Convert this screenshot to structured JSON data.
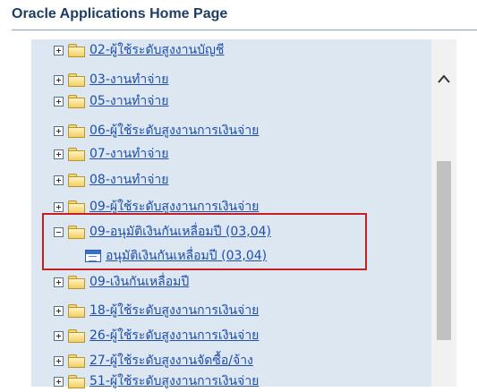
{
  "header": {
    "title": "Oracle Applications Home Page"
  },
  "tree": {
    "items": [
      {
        "type": "folder",
        "expander": "plus",
        "label": "02-ผู้ใช้ระดับสูงงานบัญชี"
      },
      {
        "type": "folder",
        "expander": "plus",
        "label": "03-งานทำจ่าย"
      },
      {
        "type": "folder",
        "expander": "plus",
        "label": "05-งานทำจ่าย"
      },
      {
        "type": "folder",
        "expander": "plus",
        "label": "06-ผู้ใช้ระดับสูงงานการเงินจ่าย"
      },
      {
        "type": "folder",
        "expander": "plus",
        "label": "07-งานทำจ่าย"
      },
      {
        "type": "folder",
        "expander": "plus",
        "label": "08-งานทำจ่าย"
      },
      {
        "type": "folder",
        "expander": "plus",
        "label": "09-ผู้ใช้ระดับสูงงานการเงินจ่าย"
      },
      {
        "type": "folder",
        "expander": "minus",
        "label": "09-อนุมัติเงินกันเหลื่อมปี (03,04)"
      },
      {
        "type": "function",
        "label": "อนุมัติเงินกันเหลื่อมปี (03,04)"
      },
      {
        "type": "folder",
        "expander": "plus",
        "label": "09-เงินกันเหลื่อมปี"
      },
      {
        "type": "folder",
        "expander": "plus",
        "label": "18-ผู้ใช้ระดับสูงงานการเงินจ่าย"
      },
      {
        "type": "folder",
        "expander": "plus",
        "label": "26-ผู้ใช้ระดับสูงงานการเงินจ่าย"
      },
      {
        "type": "folder",
        "expander": "plus",
        "label": "27-ผู้ใช้ระดับสูงงานจัดซื้อ/จ้าง"
      },
      {
        "type": "folder",
        "expander": "plus",
        "label": "51-ผู้ใช้ระดับสูงงานการเงินจ่าย"
      }
    ]
  },
  "scrollbar": {
    "up_icon": "chevron-up-icon"
  },
  "colors": {
    "link": "#1f4fa8",
    "highlight": "#c42024",
    "panel": "#dce7f2"
  }
}
